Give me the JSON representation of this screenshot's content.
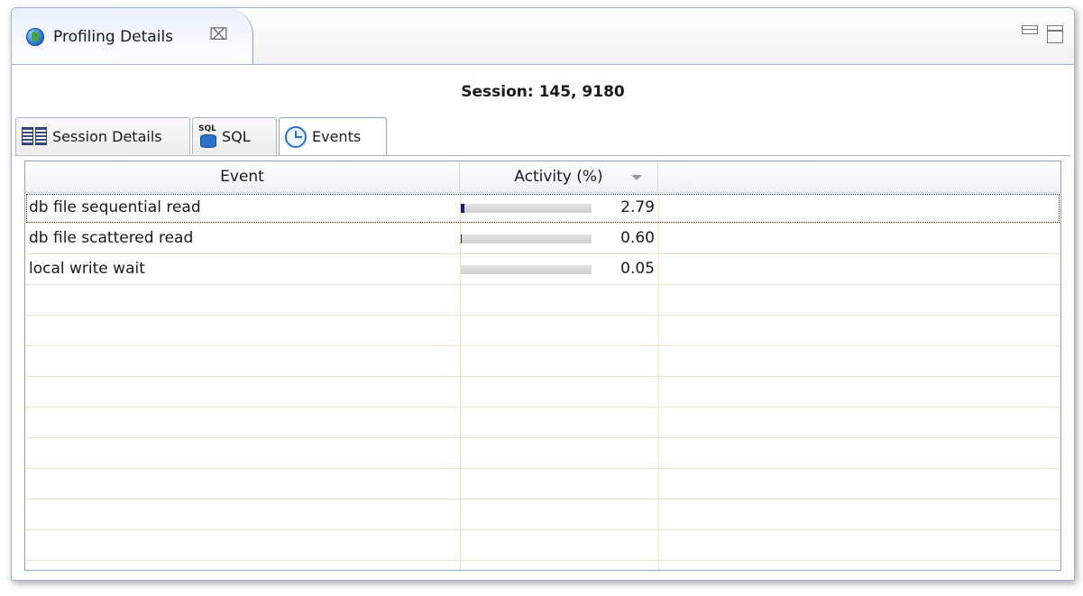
{
  "view": {
    "title": "Profiling Details",
    "close_glyph": "⌧",
    "icon": "globe-icon"
  },
  "session": {
    "title": "Session: 145, 9180"
  },
  "tabs": [
    {
      "label": "Session Details",
      "icon": "table-grid-icon"
    },
    {
      "label": "SQL",
      "icon": "sql-database-icon"
    },
    {
      "label": "Events",
      "icon": "clock-icon",
      "active": true
    }
  ],
  "table": {
    "columns": [
      "Event",
      "Activity (%)"
    ],
    "sort_column": "Activity (%)",
    "sort_direction": "descending",
    "rows": [
      {
        "event": "db file sequential read",
        "activity": "2.79",
        "activity_pct": 2.79,
        "selected": true
      },
      {
        "event": "db file scattered read",
        "activity": "0.60",
        "activity_pct": 0.6
      },
      {
        "event": "local write wait",
        "activity": "0.05",
        "activity_pct": 0.05
      }
    ],
    "bar_color": "#0b1f8c",
    "grid_color": "#f0e3cf"
  }
}
